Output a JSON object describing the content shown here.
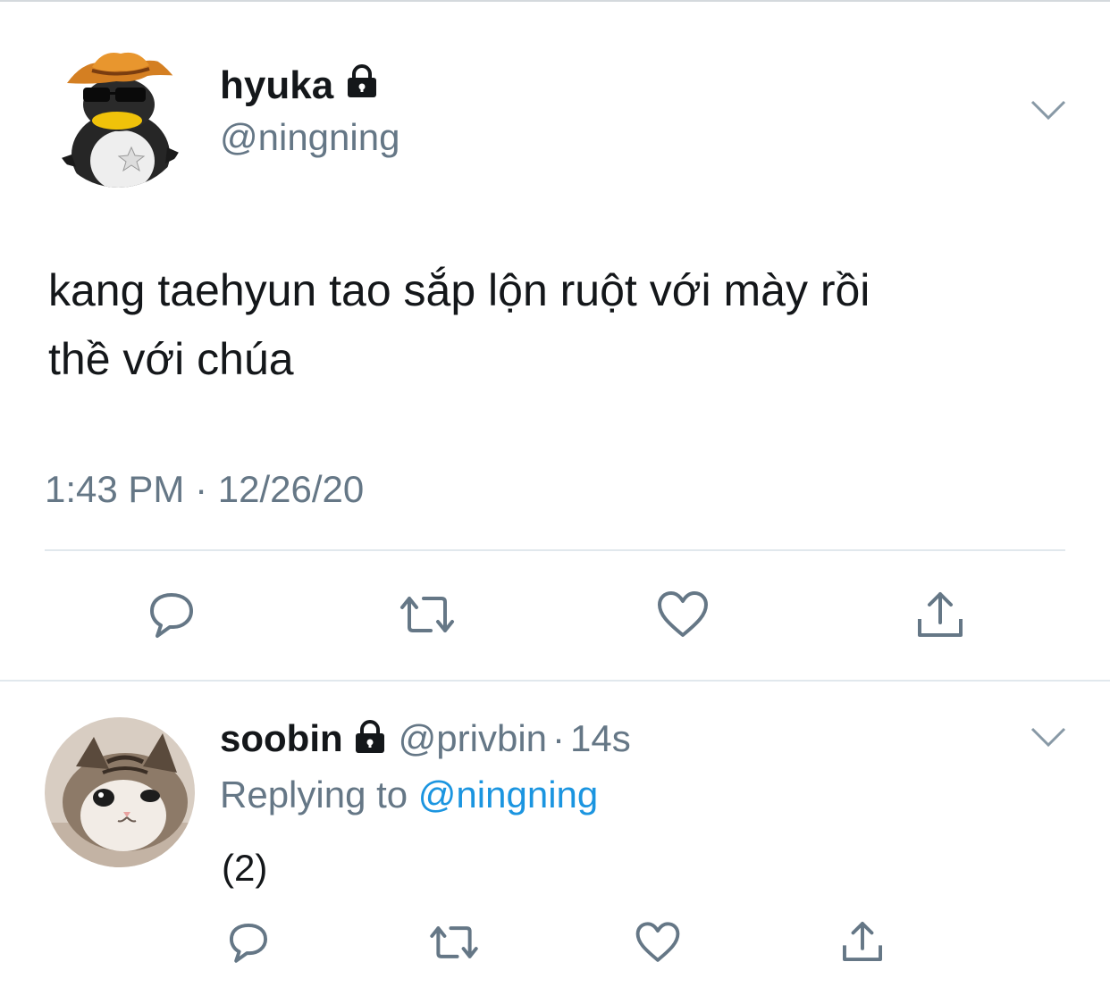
{
  "main_tweet": {
    "display_name": "hyuka",
    "handle": "@ningning",
    "text_line1": "kang taehyun tao sắp lộn ruột với mày rồi",
    "text_line2": "thề với chúa",
    "timestamp": "1:43 PM · 12/26/20",
    "avatar": "penguin-cowboy-avatar",
    "protected": true
  },
  "reply_tweet": {
    "display_name": "soobin",
    "handle": "@privbin",
    "separator": "·",
    "age": "14s",
    "replying_prefix": "Replying to ",
    "replying_handle": "@ningning",
    "text": "(2)",
    "avatar": "kitten-avatar",
    "protected": true
  },
  "actions": [
    "reply-icon",
    "retweet-icon",
    "like-icon",
    "share-icon"
  ],
  "colors": {
    "text": "#14171a",
    "secondary": "#657786",
    "link": "#1b95e0",
    "icon": "#657786",
    "divider": "#e1e8ed"
  }
}
